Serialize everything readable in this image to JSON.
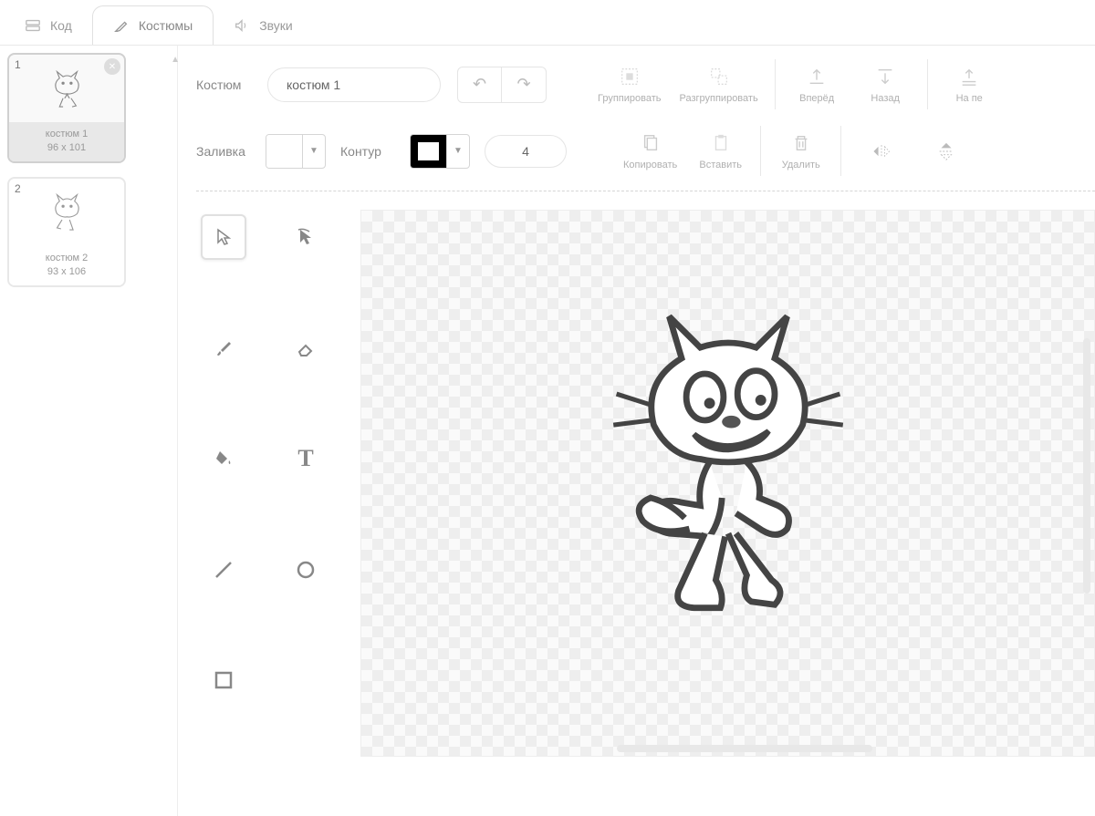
{
  "tabs": {
    "code": "Код",
    "costumes": "Костюмы",
    "sounds": "Звуки"
  },
  "costumes": [
    {
      "num": "1",
      "name": "костюм 1",
      "dims": "96 x 101"
    },
    {
      "num": "2",
      "name": "костюм 2",
      "dims": "93 x 106"
    }
  ],
  "toolbar": {
    "costume_label": "Костюм",
    "costume_name_value": "костюм 1",
    "group": "Группировать",
    "ungroup": "Разгруппировать",
    "forward": "Вперёд",
    "backward": "Назад",
    "front": "На пе",
    "fill_label": "Заливка",
    "outline_label": "Контур",
    "stroke_width": "4",
    "copy": "Копировать",
    "paste": "Вставить",
    "delete": "Удалить"
  },
  "tools": {
    "select": "select",
    "reshape": "reshape",
    "brush": "brush",
    "eraser": "eraser",
    "fill_bucket": "fill",
    "text": "text",
    "line": "line",
    "circle": "circle",
    "rect": "rect"
  }
}
